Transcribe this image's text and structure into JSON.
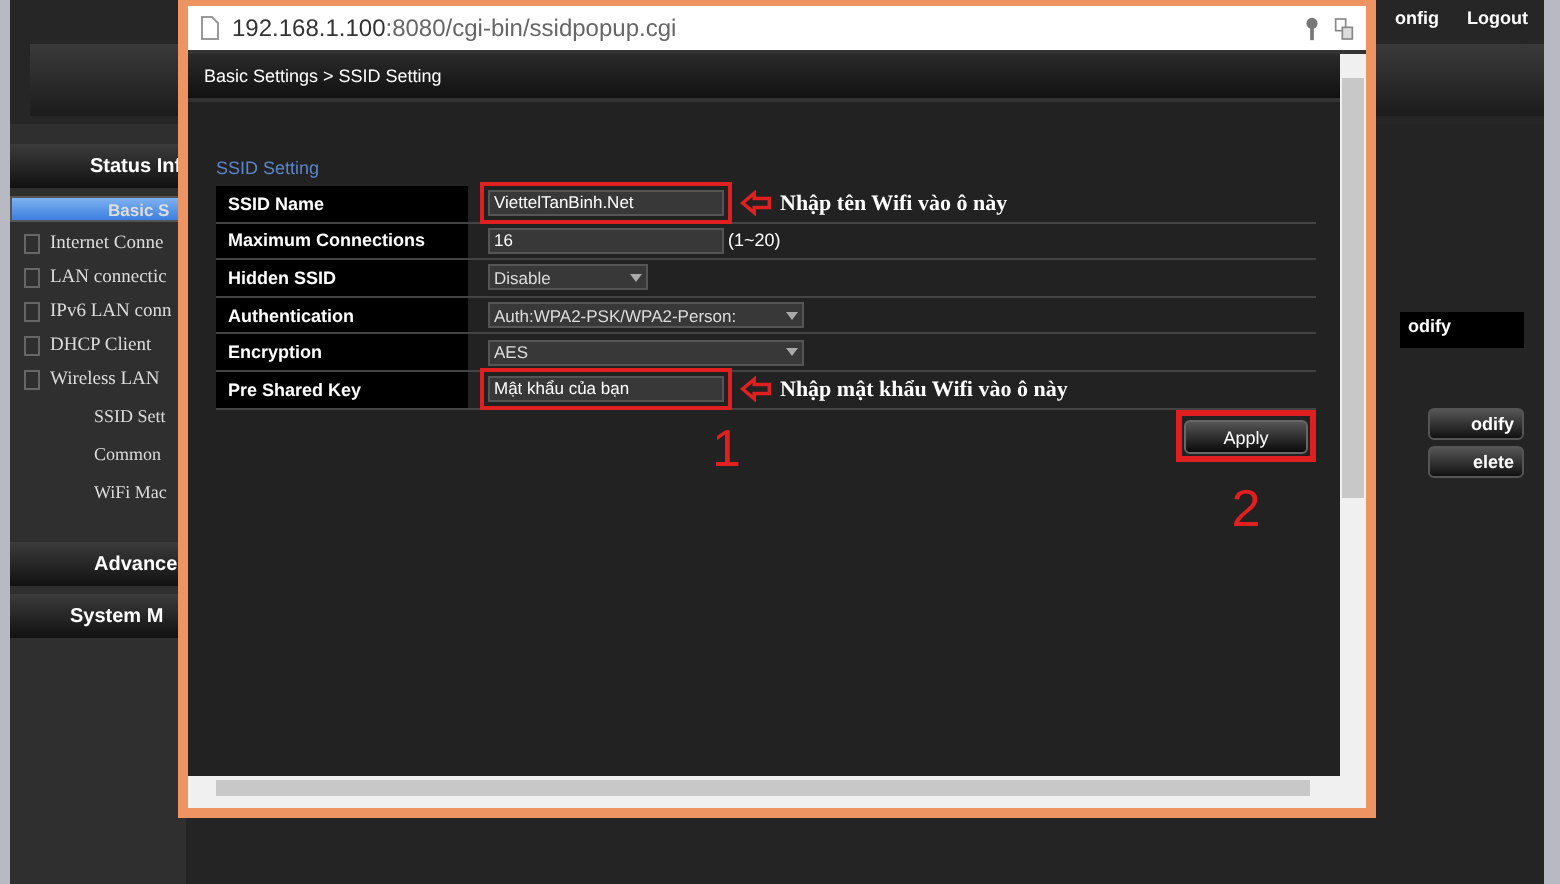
{
  "header": {
    "links": [
      "onfig",
      "Logout"
    ]
  },
  "sidebar": {
    "items": [
      {
        "kind": "menu",
        "label": "Status Inf",
        "selected": false
      },
      {
        "kind": "menu",
        "label": "Basic S",
        "selected": true
      },
      {
        "kind": "tree",
        "label": "Internet Conne",
        "selected": false
      },
      {
        "kind": "tree",
        "label": "LAN connectic",
        "selected": false
      },
      {
        "kind": "tree",
        "label": "IPv6 LAN conn",
        "selected": false
      },
      {
        "kind": "tree",
        "label": "DHCP Client",
        "selected": false
      },
      {
        "kind": "tree",
        "label": "Wireless LAN",
        "selected": false
      },
      {
        "kind": "sub",
        "label": "SSID Sett",
        "selected": false
      },
      {
        "kind": "sub",
        "label": "Common",
        "selected": false
      },
      {
        "kind": "sub",
        "label": "WiFi Mac",
        "selected": false
      },
      {
        "kind": "menu",
        "label": "Advance",
        "selected": false
      },
      {
        "kind": "menu",
        "label": "System M",
        "selected": false
      }
    ]
  },
  "background_panel": {
    "field_value": "odify",
    "buttons": [
      "odify",
      "elete"
    ]
  },
  "popup": {
    "url_host": "192.168.1.100",
    "url_rest": ":8080/cgi-bin/ssidpopup.cgi",
    "breadcrumb": "Basic Settings > SSID Setting",
    "section_title": "SSID Setting",
    "rows": [
      {
        "label": "SSID Name",
        "kind": "input",
        "value": "ViettelTanBinh.Net",
        "highlighted": true,
        "note": "Nhập tên Wifi vào ô này"
      },
      {
        "label": "Maximum Connections",
        "kind": "input",
        "value": "16",
        "hint": "(1~20)",
        "highlighted": false
      },
      {
        "label": "Hidden SSID",
        "kind": "select",
        "value": "Disable",
        "highlighted": false,
        "wide": false
      },
      {
        "label": "Authentication",
        "kind": "select",
        "value": "Auth:WPA2-PSK/WPA2-Person:",
        "highlighted": false,
        "wide": true
      },
      {
        "label": "Encryption",
        "kind": "select",
        "value": "AES",
        "highlighted": false,
        "wide": true
      },
      {
        "label": "Pre Shared Key",
        "kind": "input",
        "value": "Mật khẩu của bạn",
        "highlighted": true,
        "note": "Nhập mật khẩu Wifi vào ô này"
      }
    ],
    "step_one": "1",
    "apply": {
      "label": "Apply",
      "highlighted": true
    },
    "step_two": "2"
  }
}
